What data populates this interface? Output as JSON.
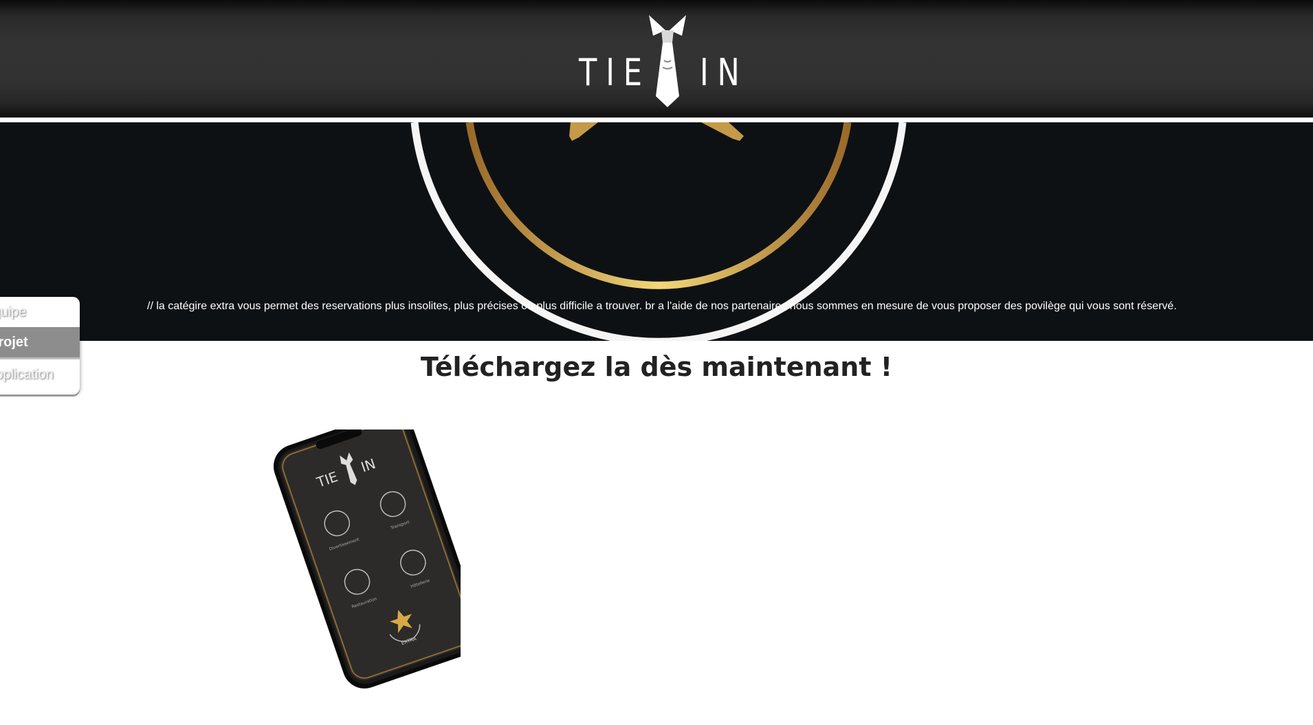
{
  "header": {
    "logo_left": "TIE",
    "logo_right": "IN"
  },
  "hero": {
    "description": "// la catégire extra vous permet des reservations plus insolites, plus précises ou plus difficile a trouver. br a l'aide de nos partenaires nous sommes en mesure de vous proposer des povilège qui vous sont réservé."
  },
  "side_nav": {
    "items": [
      {
        "label": "Equipe",
        "active": false
      },
      {
        "label": "Projet",
        "active": true
      },
      {
        "label": "Application",
        "active": false
      }
    ]
  },
  "download": {
    "title": "Téléchargez la dès maintenant !"
  },
  "phone_screen": {
    "logo_left": "TIE",
    "logo_right": "IN",
    "menu": [
      "Divertissement",
      "Transport",
      "Restauration",
      "Hôtellerie",
      "EXTRA"
    ]
  },
  "colors": {
    "gold": "#d9a846",
    "gold_light": "#f3d77a",
    "hero_bg": "#0e1114",
    "nav_active": "#8d8d8d"
  }
}
